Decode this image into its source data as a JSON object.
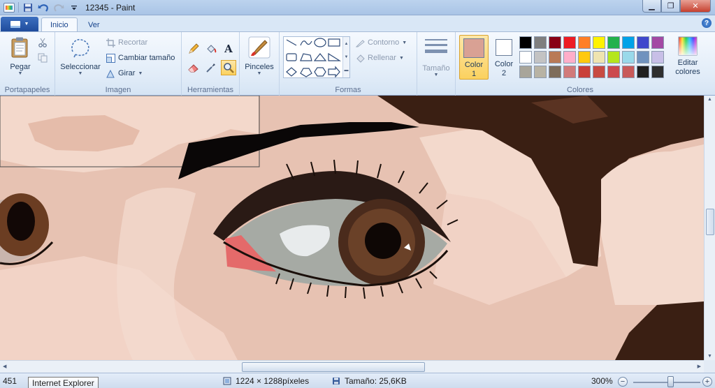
{
  "window": {
    "title": "12345 - Paint",
    "controls": [
      "minimize",
      "maximize",
      "close"
    ]
  },
  "ribbon_tabs": [
    {
      "label": "Inicio",
      "active": true
    },
    {
      "label": "Ver",
      "active": false
    }
  ],
  "groups": {
    "clipboard": {
      "label": "Portapapeles",
      "paste": "Pegar"
    },
    "image": {
      "label": "Imagen",
      "select": "Seleccionar",
      "crop": "Recortar",
      "resize": "Cambiar tamaño",
      "rotate": "Girar"
    },
    "tools": {
      "label": "Herramientas",
      "active_tool": "magnifier"
    },
    "brushes": {
      "label": "Pinceles"
    },
    "shapes": {
      "label": "Formas",
      "outline": "Contorno",
      "fill": "Rellenar"
    },
    "size": {
      "label": "Tamaño"
    },
    "colors": {
      "label": "Colores",
      "color1_label": "Color",
      "color1_num": "1",
      "color2_label": "Color",
      "color2_num": "2",
      "edit_line1": "Editar",
      "edit_line2": "colores",
      "color1": "#d9a194",
      "color2": "#ffffff",
      "palette": [
        "#000000",
        "#7f7f7f",
        "#880015",
        "#ed1c24",
        "#ff7f27",
        "#fff200",
        "#22b14c",
        "#00a2e8",
        "#3f48cc",
        "#a349a4",
        "#ffffff",
        "#c3c3c3",
        "#b97a57",
        "#ffaec9",
        "#ffc90e",
        "#efe4b0",
        "#b5e61d",
        "#99d9ea",
        "#7092be",
        "#c8bfe7",
        "#a8a59a",
        "#b8b3a4",
        "#7e6d5b",
        "#d17a7a",
        "#c9403a",
        "#c84b42",
        "#cc4a4e",
        "#c85a5a",
        "#202020",
        "#2f2f2f"
      ]
    }
  },
  "status": {
    "cursor_pos": "451",
    "tooltip": "Internet Explorer",
    "dimensions": "1224 × 1288píxeles",
    "size": "Tamaño: 25,6KB",
    "zoom": "300%"
  }
}
